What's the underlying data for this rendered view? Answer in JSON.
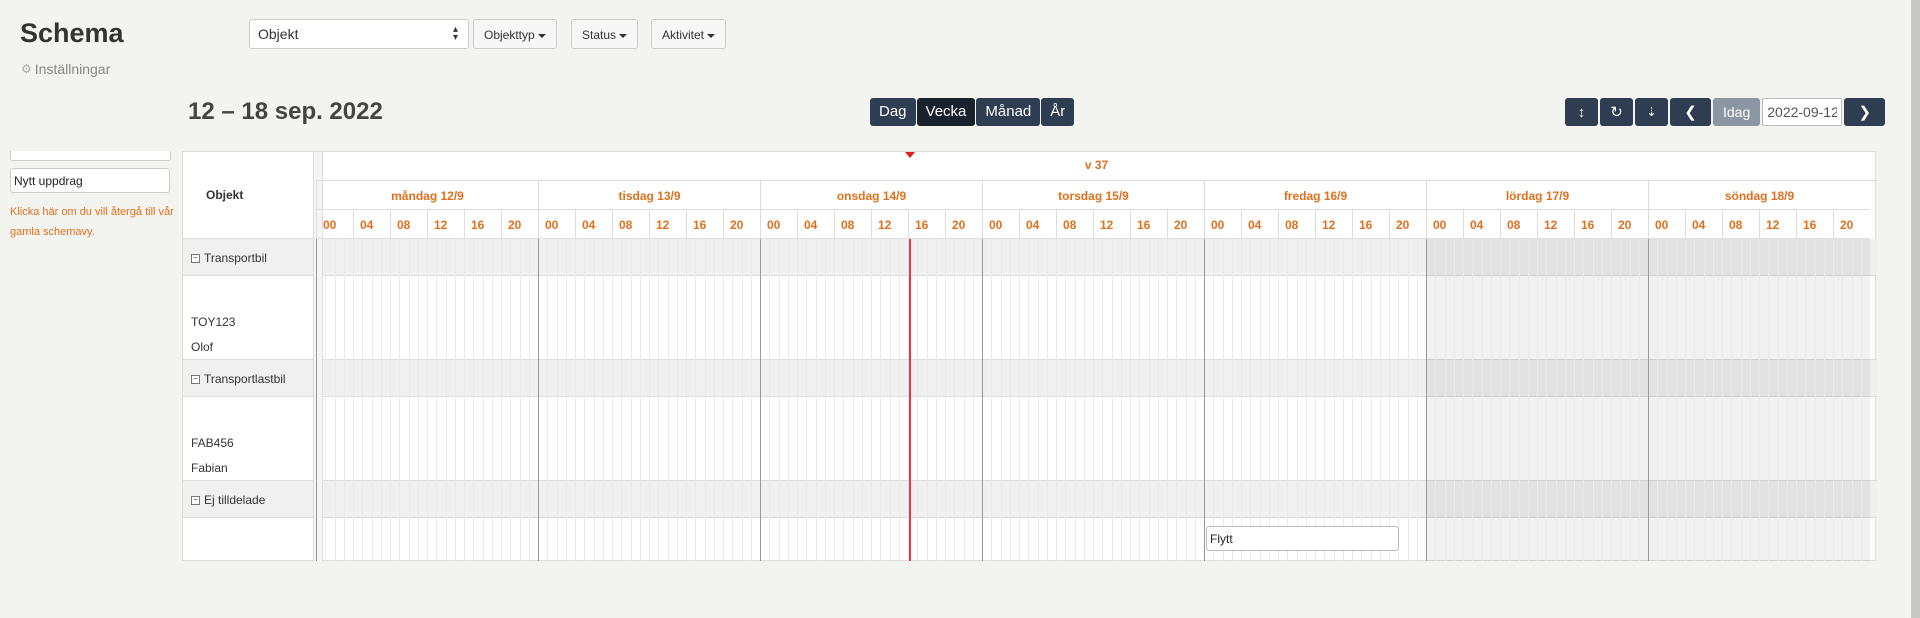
{
  "header": {
    "title": "Schema",
    "settings_label": "Inställningar",
    "object_select": "Objekt",
    "filters": [
      "Objekttyp",
      "Status",
      "Aktivitet"
    ]
  },
  "toolbar": {
    "date_range": "12 – 18 sep. 2022",
    "views": [
      {
        "label": "Dag",
        "active": false
      },
      {
        "label": "Vecka",
        "active": true
      },
      {
        "label": "Månad",
        "active": false
      },
      {
        "label": "År",
        "active": false
      }
    ],
    "today_label": "Idag",
    "date_value": "2022-09-12"
  },
  "sidebar": {
    "new_task_value": "Nytt uppdrag",
    "old_view_note": "Klicka här om du vill återgå till vår gamla schemavy."
  },
  "grid": {
    "objects_header": "Objekt",
    "week_label": "v 37",
    "days": [
      "måndag 12/9",
      "tisdag 13/9",
      "onsdag 14/9",
      "torsdag 15/9",
      "fredag 16/9",
      "lördag 17/9",
      "söndag 18/9"
    ],
    "hours": [
      "00",
      "04",
      "08",
      "12",
      "16",
      "20"
    ],
    "rows": [
      {
        "type": "group",
        "label": "Transportbil"
      },
      {
        "type": "item",
        "lines": [
          "TOY123",
          "Olof"
        ]
      },
      {
        "type": "group",
        "label": "Transportlastbil"
      },
      {
        "type": "item",
        "lines": [
          "FAB456",
          "Fabian"
        ]
      },
      {
        "type": "group",
        "label": "Ej tilldelade"
      },
      {
        "type": "item",
        "lines": []
      }
    ],
    "events": [
      {
        "label": "Flytt",
        "day": "fredag 16/9"
      }
    ]
  },
  "colors": {
    "accent": "#e0701e",
    "button_dark": "#2e3d52",
    "now_line": "#e23b36"
  }
}
